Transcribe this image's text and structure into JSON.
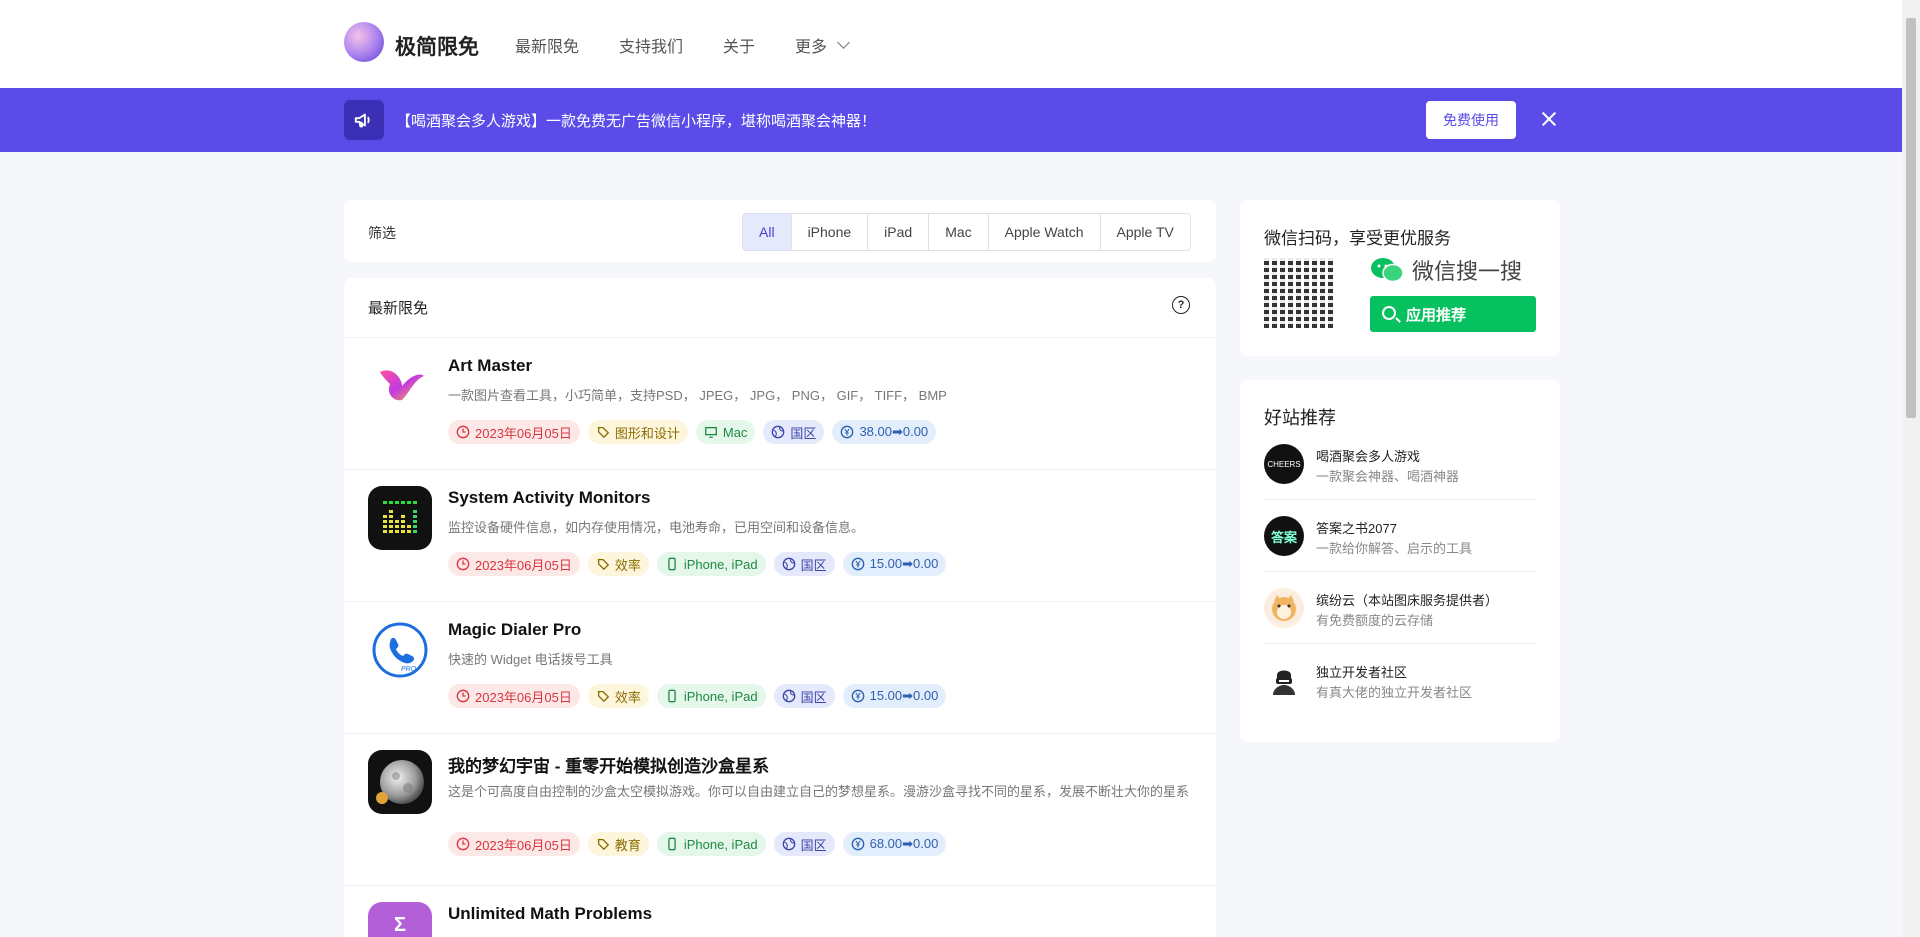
{
  "header": {
    "brand": "极简限免",
    "nav": [
      "最新限免",
      "支持我们",
      "关于",
      "更多"
    ]
  },
  "banner": {
    "text": "【喝酒聚会多人游戏】一款免费无广告微信小程序，堪称喝酒聚会神器！",
    "button": "免费使用"
  },
  "filter": {
    "label": "筛选",
    "options": [
      "All",
      "iPhone",
      "iPad",
      "Mac",
      "Apple Watch",
      "Apple TV"
    ],
    "selected": "All"
  },
  "list": {
    "title": "最新限免",
    "items": [
      {
        "name": "Art Master",
        "desc": "一款图片查看工具，小巧简单，支持PSD， JPEG， JPG， PNG， GIF， TIFF， BMP",
        "date": "2023年06月05日",
        "category": "图形和设计",
        "devices": "Mac",
        "region": "国区",
        "price": "38.00➡0.00"
      },
      {
        "name": "System Activity Monitors",
        "desc": "监控设备硬件信息，如内存使用情况，电池寿命，已用空间和设备信息。",
        "date": "2023年06月05日",
        "category": "效率",
        "devices": "iPhone, iPad",
        "region": "国区",
        "price": "15.00➡0.00"
      },
      {
        "name": "Magic Dialer Pro",
        "desc": "快速的 Widget 电话拨号工具",
        "date": "2023年06月05日",
        "category": "效率",
        "devices": "iPhone, iPad",
        "region": "国区",
        "price": "15.00➡0.00"
      },
      {
        "name": "我的梦幻宇宙 - 重零开始模拟创造沙盒星系",
        "desc": "这是个可高度自由控制的沙盒太空模拟游戏。你可以自由建立自己的梦想星系。漫游沙盒寻找不同的星系，发展不断壮大你的星系",
        "date": "2023年06月05日",
        "category": "教育",
        "devices": "iPhone, iPad",
        "region": "国区",
        "price": "68.00➡0.00"
      },
      {
        "name": "Unlimited Math Problems"
      }
    ]
  },
  "wechat": {
    "title": "微信扫码，享受更优服务",
    "search_text": "微信搜一搜",
    "button": "应用推荐"
  },
  "sites": {
    "title": "好站推荐",
    "items": [
      {
        "name": "喝酒聚会多人游戏",
        "desc": "一款聚会神器、喝酒神器"
      },
      {
        "name": "答案之书2077",
        "desc": "一款给你解答、启示的工具"
      },
      {
        "name": "缤纷云（本站图床服务提供者）",
        "desc": "有免费额度的云存储"
      },
      {
        "name": "独立开发者社区",
        "desc": "有真大佬的独立开发者社区"
      }
    ]
  },
  "colors": {
    "banner": "#5b4be8",
    "wechat_green": "#07c160"
  }
}
